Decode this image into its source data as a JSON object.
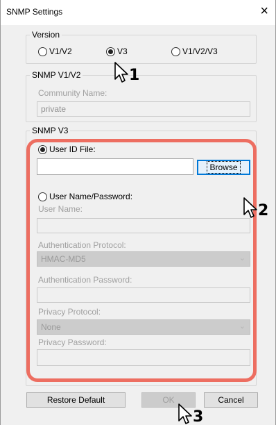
{
  "dialog": {
    "title": "SNMP Settings",
    "close_label": "×"
  },
  "version": {
    "legend": "Version",
    "options": [
      "V1/V2",
      "V3",
      "V1/V2/V3"
    ],
    "selected": "V3"
  },
  "snmp_v1v2": {
    "legend": "SNMP V1/V2",
    "community_label": "Community Name:",
    "community_value": "private"
  },
  "snmp_v3": {
    "legend": "SNMP V3",
    "user_id_file_label": "User ID File:",
    "user_id_file_value": "",
    "browse_label": "Browse",
    "user_name_password_label": "User Name/Password:",
    "user_name_label": "User Name:",
    "user_name_value": "",
    "auth_protocol_label": "Authentication Protocol:",
    "auth_protocol_value": "HMAC-MD5",
    "auth_password_label": "Authentication Password:",
    "auth_password_value": "",
    "privacy_protocol_label": "Privacy Protocol:",
    "privacy_protocol_value": "None",
    "privacy_password_label": "Privacy Password:",
    "privacy_password_value": "",
    "selected_mode": "User ID File"
  },
  "footer": {
    "restore_default_label": "Restore Default",
    "ok_label": "OK",
    "cancel_label": "Cancel"
  },
  "callouts": [
    "1",
    "2",
    "3"
  ],
  "colors": {
    "highlight": "#ed6e61",
    "focus": "#0078d7"
  },
  "icons": {
    "chevron": "chevron-down-icon",
    "cursor": "mouse-pointer-icon"
  }
}
